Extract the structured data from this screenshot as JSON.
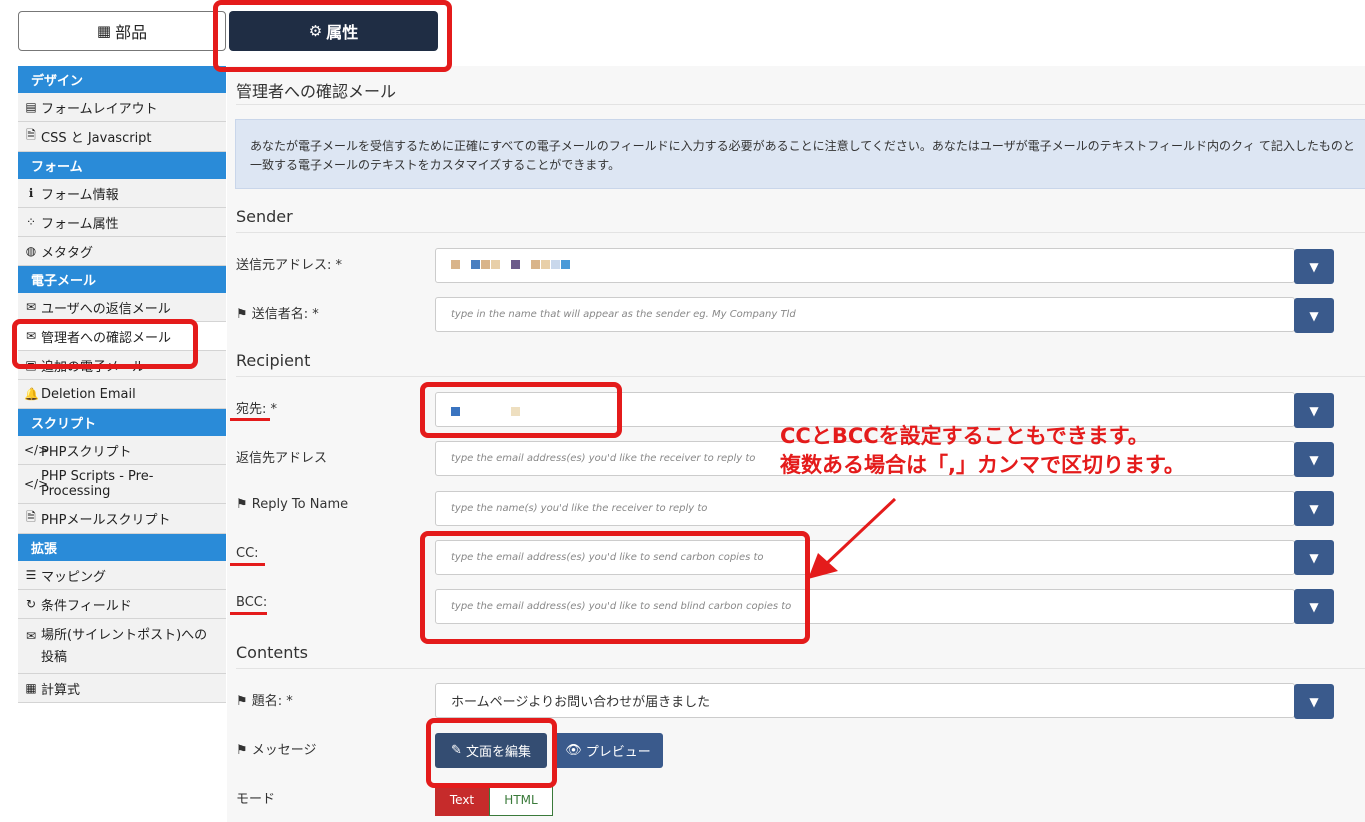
{
  "tabs": {
    "parts": {
      "label": "部品",
      "icon": "grid-icon"
    },
    "attributes": {
      "label": "属性",
      "icon": "gears-icon"
    }
  },
  "sidebar": {
    "groups": [
      {
        "heading": "デザイン",
        "items": [
          {
            "label": "フォームレイアウト",
            "icon": "layout-icon"
          },
          {
            "label": "CSS と Javascript",
            "icon": "code-file-icon"
          }
        ]
      },
      {
        "heading": "フォーム",
        "items": [
          {
            "label": "フォーム情報",
            "icon": "info-icon"
          },
          {
            "label": "フォーム属性",
            "icon": "dots-icon"
          },
          {
            "label": "メタタグ",
            "icon": "globe-icon"
          }
        ]
      },
      {
        "heading": "電子メール",
        "items": [
          {
            "label": "ユーザへの返信メール",
            "icon": "envelope-outline-icon"
          },
          {
            "label": "管理者への確認メール",
            "icon": "envelope-icon"
          },
          {
            "label": "追加の電子メール",
            "icon": "envelope-plus-icon"
          },
          {
            "label": "Deletion Email",
            "icon": "bell-icon"
          }
        ]
      },
      {
        "heading": "スクリプト",
        "items": [
          {
            "label": "PHPスクリプト",
            "icon": "code-icon"
          },
          {
            "label": "PHP Scripts - Pre-Processing",
            "icon": "code-icon"
          },
          {
            "label": "PHPメールスクリプト",
            "icon": "code-file-icon"
          }
        ]
      },
      {
        "heading": "拡張",
        "items": [
          {
            "label": "マッピング",
            "icon": "database-icon"
          },
          {
            "label": "条件フィールド",
            "icon": "refresh-icon"
          },
          {
            "label": "場所(サイレントポスト)への投稿",
            "icon": "envelope-icon"
          },
          {
            "label": "計算式",
            "icon": "calculator-icon"
          }
        ]
      }
    ]
  },
  "main": {
    "title": "管理者への確認メール",
    "info": "あなたが電子メールを受信するために正確にすべての電子メールのフィールドに入力する必要があることに注意してください。あなたはユーザが電子メールのテキストフィールド内のクィ て記入したものと一致する電子メールのテキストをカスタマイズすることができます。",
    "sections": {
      "sender": "Sender",
      "recipient": "Recipient",
      "contents": "Contents"
    },
    "fields": {
      "from_address": {
        "label": "送信元アドレス: *"
      },
      "sender_name": {
        "label": "送信者名: *",
        "placeholder": "type in the name that will appear as the sender eg. My Company Tld"
      },
      "to": {
        "label": "宛先: *"
      },
      "reply_to": {
        "label": "返信先アドレス",
        "placeholder": "type the email address(es) you'd like the receiver to reply to"
      },
      "reply_to_name": {
        "label": "Reply To Name",
        "placeholder": "type the name(s) you'd like the receiver to reply to"
      },
      "cc": {
        "label": "CC:",
        "placeholder": "type the email address(es) you'd like to send carbon copies to"
      },
      "bcc": {
        "label": "BCC:",
        "placeholder": "type the email address(es) you'd like to send blind carbon copies to"
      },
      "subject": {
        "label": "題名: *",
        "value": "ホームページよりお問い合わせが届きました"
      },
      "message": {
        "label": "メッセージ"
      },
      "mode": {
        "label": "モード"
      }
    },
    "buttons": {
      "edit": "文面を編集",
      "preview": "プレビュー"
    },
    "mode_options": {
      "text": "Text",
      "html": "HTML",
      "selected": "Text"
    }
  },
  "annotation": {
    "line1": "CCとBCCを設定することもできます。",
    "line2": "複数ある場合は「,」カンマで区切ります。",
    "color": "#e41b1b"
  }
}
